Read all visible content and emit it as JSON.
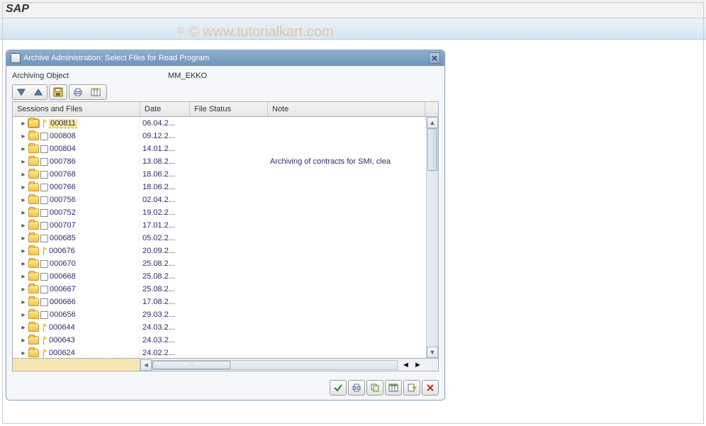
{
  "app": {
    "title": "SAP"
  },
  "watermark": "© www.tutorialkart.com",
  "dialog": {
    "title": "Archive Administration: Select Files for Read Program",
    "field_label": "Archiving Object",
    "field_value": "MM_EKKO"
  },
  "columns": {
    "sessions": "Sessions and Files",
    "date": "Date",
    "status": "File Status",
    "note": "Note"
  },
  "rows": [
    {
      "id": "000811",
      "date": "06.04.2...",
      "note": "",
      "flagged": true,
      "selected": true
    },
    {
      "id": "000808",
      "date": "09.12.2...",
      "note": "",
      "flagged": false,
      "selected": false
    },
    {
      "id": "000804",
      "date": "14.01.2...",
      "note": "",
      "flagged": false,
      "selected": false
    },
    {
      "id": "000786",
      "date": "13.08.2...",
      "note": "Archiving of contracts for SMI, clea",
      "flagged": false,
      "selected": false
    },
    {
      "id": "000768",
      "date": "18.06.2...",
      "note": "",
      "flagged": false,
      "selected": false
    },
    {
      "id": "000766",
      "date": "18.06.2...",
      "note": "",
      "flagged": false,
      "selected": false
    },
    {
      "id": "000756",
      "date": "02.04.2...",
      "note": "",
      "flagged": false,
      "selected": false
    },
    {
      "id": "000752",
      "date": "19.02.2...",
      "note": "",
      "flagged": false,
      "selected": false
    },
    {
      "id": "000707",
      "date": "17.01.2...",
      "note": "",
      "flagged": false,
      "selected": false
    },
    {
      "id": "000685",
      "date": "05.02.2...",
      "note": "",
      "flagged": false,
      "selected": false
    },
    {
      "id": "000676",
      "date": "20.09.2...",
      "note": "",
      "flagged": true,
      "selected": false
    },
    {
      "id": "000670",
      "date": "25.08.2...",
      "note": "",
      "flagged": false,
      "selected": false
    },
    {
      "id": "000668",
      "date": "25.08.2...",
      "note": "",
      "flagged": false,
      "selected": false
    },
    {
      "id": "000667",
      "date": "25.08.2...",
      "note": "",
      "flagged": false,
      "selected": false
    },
    {
      "id": "000666",
      "date": "17.08.2...",
      "note": "",
      "flagged": false,
      "selected": false
    },
    {
      "id": "000656",
      "date": "29.03.2...",
      "note": "",
      "flagged": false,
      "selected": false
    },
    {
      "id": "000644",
      "date": "24.03.2...",
      "note": "",
      "flagged": true,
      "selected": false
    },
    {
      "id": "000643",
      "date": "24.03.2...",
      "note": "",
      "flagged": true,
      "selected": false
    },
    {
      "id": "000624",
      "date": "24.02.2...",
      "note": "",
      "flagged": true,
      "selected": false
    }
  ],
  "icons": {
    "expand_all": "expand-all",
    "collapse_all": "collapse-all",
    "save": "save",
    "print": "print",
    "layout": "layout",
    "ok": "ok",
    "print2": "print",
    "copy": "copy",
    "table": "table-settings",
    "export": "export",
    "cancel": "cancel"
  }
}
